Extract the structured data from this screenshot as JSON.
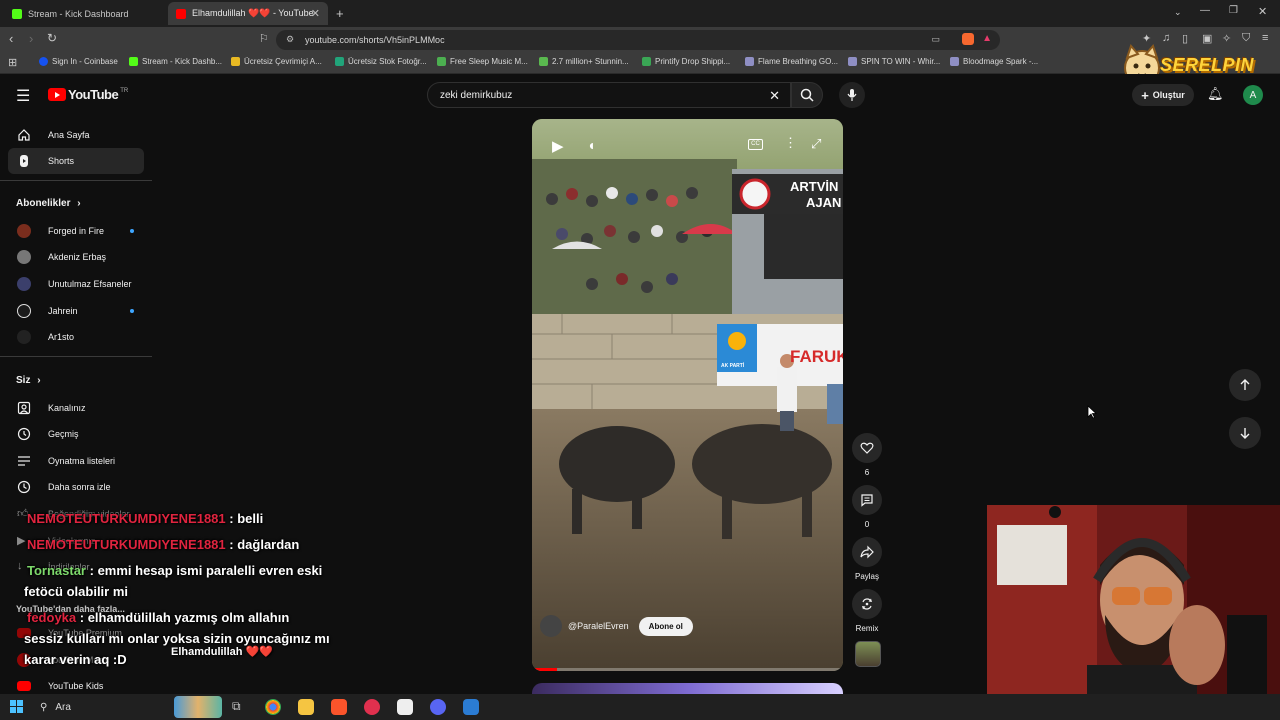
{
  "browser": {
    "tabs": [
      {
        "title": "Stream - Kick Dashboard",
        "active": false
      },
      {
        "title": "Elhamdulillah ❤️❤️ - YouTube",
        "active": true
      }
    ],
    "url": "youtube.com/shorts/Vh5inPLMMoc",
    "bookmarks": [
      "Sign In - Coinbase",
      "Stream - Kick Dashb...",
      "Ücretsiz Çevrimiçi A...",
      "Ücretsiz Stok Fotoğr...",
      "Free Sleep Music M...",
      "2.7 million+ Stunnin...",
      "Printify Drop Shippi...",
      "Flame Breathing GO...",
      "SPIN TO WIN - Whir...",
      "Bloodmage Spark -..."
    ]
  },
  "overlay_logo": "SERELPIN",
  "youtube": {
    "logo": "YouTube",
    "logo_region": "TR",
    "search_value": "zeki demirkubuz",
    "create_label": "Oluştur",
    "avatar_letter": "A",
    "sidebar": {
      "main": [
        "Ana Sayfa",
        "Shorts"
      ],
      "subscriptions_title": "Abonelikler",
      "subscriptions": [
        "Forged in Fire",
        "Akdeniz Erbaş",
        "Unutulmaz Efsaneler",
        "Jahrein",
        "Ar1sto"
      ],
      "you_title": "Siz",
      "you_items": [
        "Kanalınız",
        "Geçmiş",
        "Oynatma listeleri",
        "Daha sonra izle",
        "Beğendiğim videolar",
        "Videolarınız",
        "İndirilenler"
      ],
      "more_title": "YouTube'dan daha fazla...",
      "more_items": [
        "YouTube Premium",
        "YouTube Music",
        "YouTube Kids"
      ]
    },
    "short": {
      "channel": "@ParalelEvren",
      "subscribe_label": "Abone ol",
      "title": "Elhamdulillah ❤️❤️",
      "likes": "6",
      "comments": "0",
      "share_label": "Paylaş",
      "remix_label": "Remix",
      "banner_top": "ARTVİN",
      "banner_top2": "AJAN",
      "banner_party": "FARUK",
      "banner_party_sub": "AK PARTİ",
      "progress": 0.08
    }
  },
  "chat": [
    {
      "user": "NEMOTEUTURKUMDIYENE1881",
      "message": ": belli"
    },
    {
      "user": "NEMOTEUTURKUMDIYENE1881",
      "message": ": dağlardan"
    },
    {
      "user": "Tornastar",
      "message": ": emmi hesap ismi paralelli evren eski"
    },
    {
      "user": "",
      "message": "fetöcü olabilir mi"
    },
    {
      "user": "fedoyka",
      "message": ": elhamdülillah yazmış olm allahın"
    },
    {
      "user": "",
      "message": "sessiz kulları mı onlar yoksa sizin oyuncağınız mı"
    },
    {
      "user": "",
      "message": "karar verin aq :D"
    }
  ],
  "taskbar": {
    "search_label": "Ara"
  },
  "colors": {
    "accent": "#3ea6ff",
    "youtube_red": "#ff0000",
    "chat_user": "#e0243f",
    "chat_user2": "#7dd96b"
  }
}
